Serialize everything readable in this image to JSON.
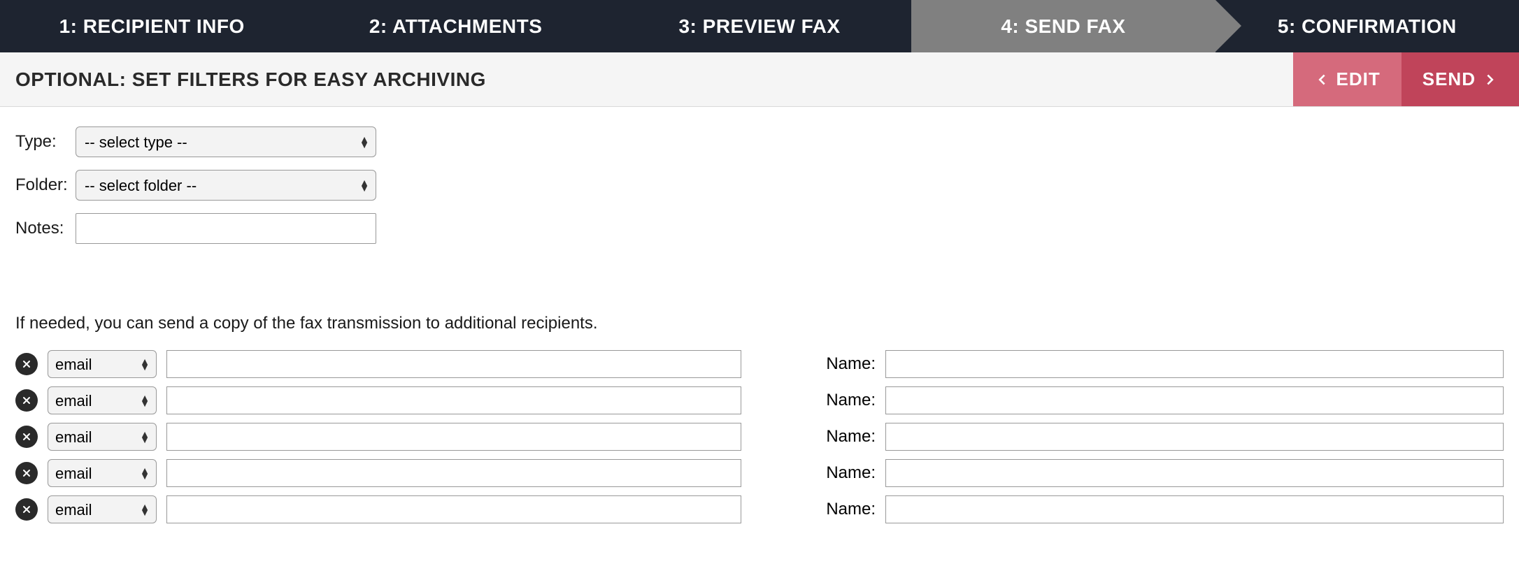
{
  "steps": [
    {
      "label": "1: RECIPIENT INFO"
    },
    {
      "label": "2: ATTACHMENTS"
    },
    {
      "label": "3: PREVIEW FAX"
    },
    {
      "label": "4: SEND FAX"
    },
    {
      "label": "5: CONFIRMATION"
    }
  ],
  "subheader": {
    "title": "OPTIONAL: SET FILTERS FOR EASY ARCHIVING",
    "edit_label": "EDIT",
    "send_label": "SEND"
  },
  "filters": {
    "type_label": "Type:",
    "type_placeholder": "-- select type --",
    "folder_label": "Folder:",
    "folder_placeholder": "-- select folder --",
    "notes_label": "Notes:",
    "notes_value": ""
  },
  "copy_note": "If needed, you can send a copy of the fax transmission to additional recipients.",
  "cc": {
    "name_label": "Name:",
    "default_type": "email",
    "rows": [
      {
        "type": "email",
        "value": "",
        "name": ""
      },
      {
        "type": "email",
        "value": "",
        "name": ""
      },
      {
        "type": "email",
        "value": "",
        "name": ""
      },
      {
        "type": "email",
        "value": "",
        "name": ""
      },
      {
        "type": "email",
        "value": "",
        "name": ""
      }
    ]
  }
}
